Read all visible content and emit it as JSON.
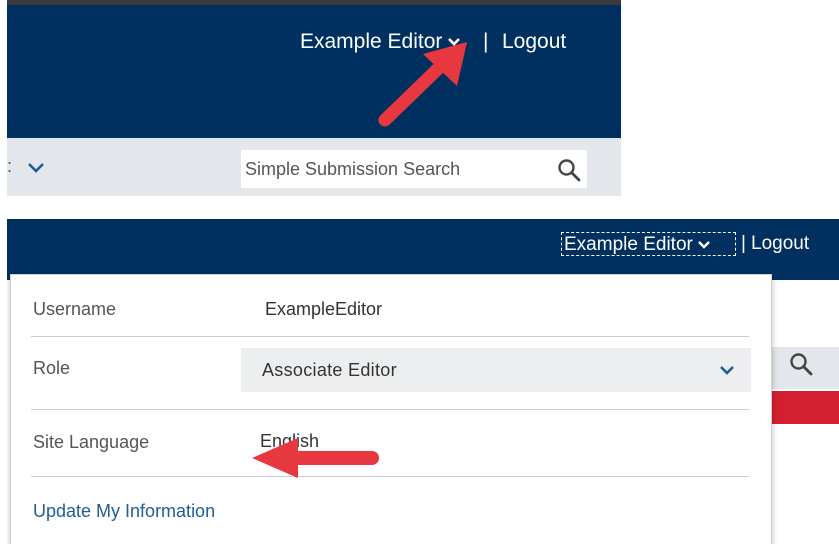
{
  "panel1": {
    "header": {
      "user_menu_label": "Example Editor",
      "separator": "|",
      "logout_label": "Logout"
    },
    "subbar": {
      "partial_text": ":",
      "search": {
        "placeholder": "Simple Submission Search"
      }
    }
  },
  "panel2": {
    "header": {
      "user_menu_label": "Example Editor",
      "separator": "|",
      "logout_label": "Logout"
    },
    "dropdown": {
      "username_label": "Username",
      "username_value": "ExampleEditor",
      "role_label": "Role",
      "role_value": "Associate Editor",
      "language_label": "Site Language",
      "language_value": "English",
      "update_link": "Update My Information"
    }
  },
  "colors": {
    "header_navy": "#00305f",
    "subbar_gray": "#e3e6ea",
    "link_blue": "#1f5d96",
    "arrow_red": "#e8383f",
    "accent_red": "#d41f30",
    "chevron_blue": "#1f5d96"
  },
  "icons": [
    "chevron-down-icon",
    "search-icon",
    "red-arrow-annotation"
  ]
}
